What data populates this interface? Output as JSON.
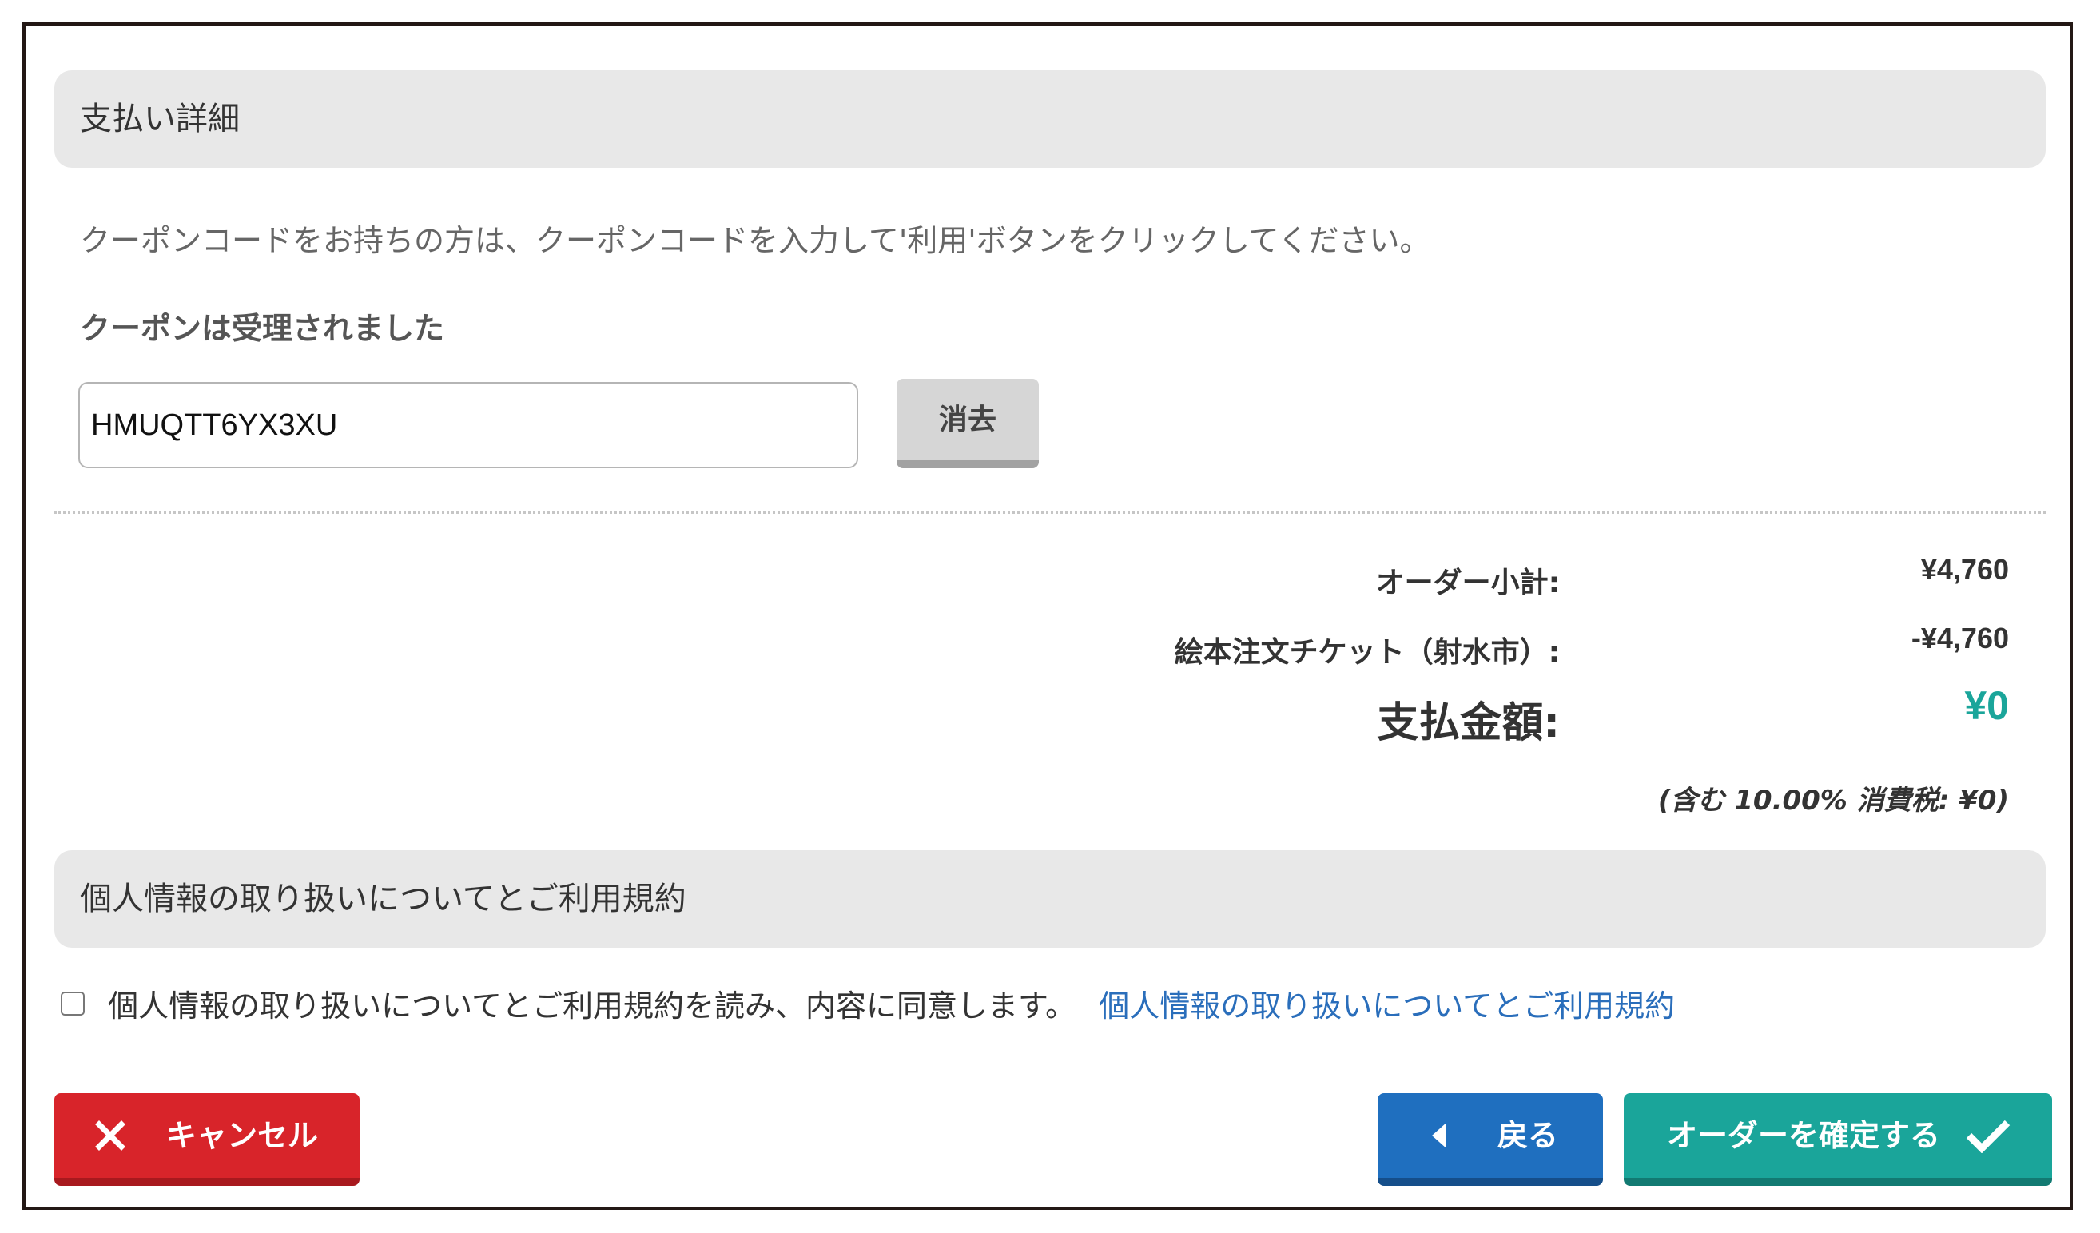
{
  "payment": {
    "header": "支払い詳細",
    "instruction": "クーポンコードをお持ちの方は、クーポンコードを入力して'利用'ボタンをクリックしてください。",
    "accepted_message": "クーポンは受理されました",
    "coupon_code": "HMUQTT6YX3XU",
    "clear_label": "消去"
  },
  "summary": {
    "subtotal_label": "オーダー小計:",
    "subtotal_value": "¥4,760",
    "ticket_label": "絵本注文チケット（射水市）:",
    "ticket_value": "-¥4,760",
    "total_label": "支払金額:",
    "total_value": "¥0",
    "tax_note": "(含む 10.00% 消費税: ¥0)"
  },
  "privacy": {
    "header": "個人情報の取り扱いについてとご利用規約",
    "agree_text": "個人情報の取り扱いについてとご利用規約を読み、内容に同意します。",
    "link_text": "個人情報の取り扱いについてとご利用規約",
    "agreed": false
  },
  "buttons": {
    "cancel_label": "キャンセル",
    "back_label": "戻る",
    "confirm_label": "オーダーを確定する"
  },
  "icons": {
    "cancel": "close-icon",
    "back": "caret-left-icon",
    "confirm": "checkmark-icon"
  },
  "colors": {
    "cancel": "#d8242a",
    "back": "#1f6fbf",
    "confirm": "#1aa59a",
    "total_value": "#1aa59a",
    "link": "#2a6ebb"
  }
}
